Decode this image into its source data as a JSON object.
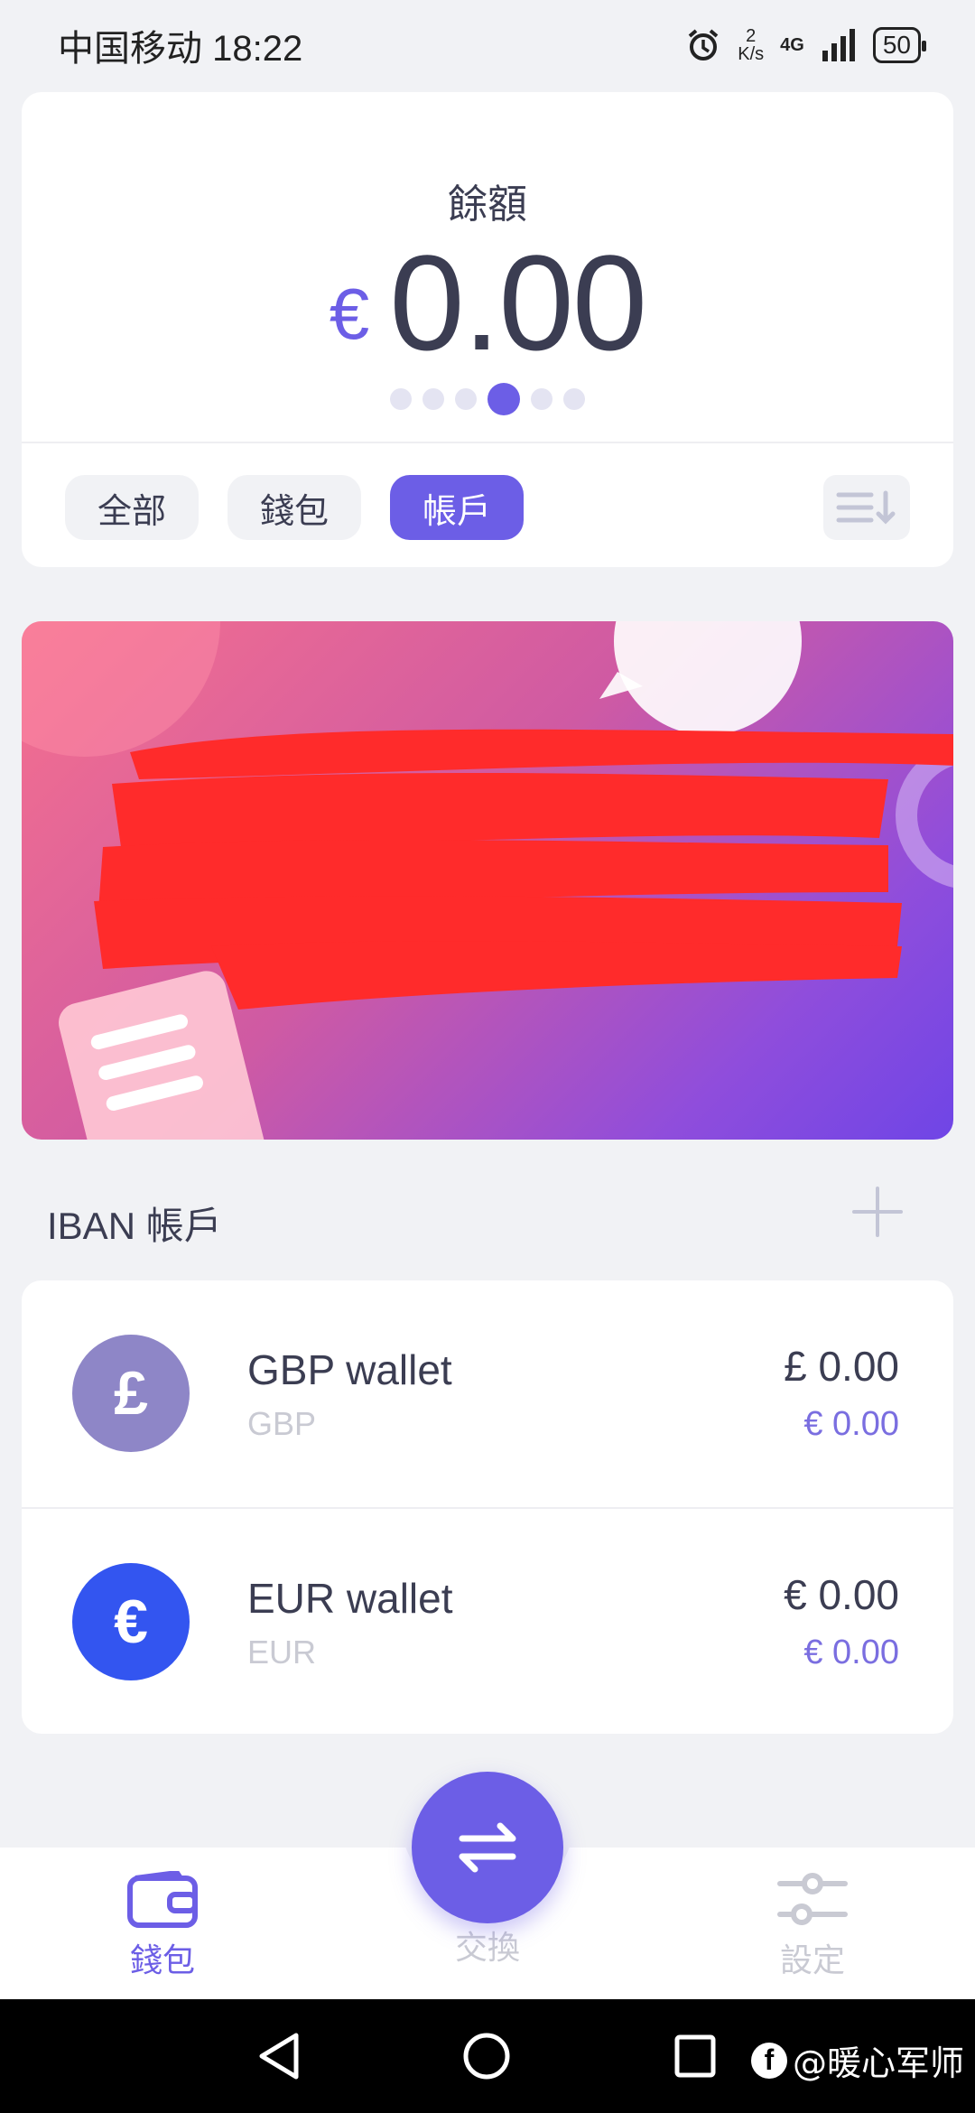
{
  "status_bar": {
    "carrier": "中国移动",
    "time": "18:22",
    "speed_value": "2",
    "speed_unit": "K/s",
    "network": "4G",
    "battery": "50",
    "icons": [
      "alarm-icon",
      "signal-icon",
      "battery-icon"
    ]
  },
  "balance": {
    "title": "餘額",
    "currency_symbol": "€",
    "amount": "0.00",
    "page_count": 6,
    "active_page": 4
  },
  "filters": {
    "items": [
      {
        "label": "全部",
        "active": false
      },
      {
        "label": "錢包",
        "active": false
      },
      {
        "label": "帳戶",
        "active": true
      }
    ],
    "sort_icon": "sort-list-icon"
  },
  "section": {
    "title": "IBAN 帳戶",
    "add_icon": "plus-icon"
  },
  "wallets": [
    {
      "symbol": "£",
      "name": "GBP wallet",
      "code": "GBP",
      "balance": "£ 0.00",
      "eur_value": "€ 0.00",
      "color": "#8e86c7"
    },
    {
      "symbol": "€",
      "name": "EUR wallet",
      "code": "EUR",
      "balance": "€ 0.00",
      "eur_value": "€ 0.00",
      "color": "#3355f0"
    }
  ],
  "bottom_nav": {
    "wallet_label": "錢包",
    "exchange_label": "交換",
    "settings_label": "設定"
  },
  "watermark": {
    "logo": "f",
    "text": "@暖心军师"
  },
  "colors": {
    "accent": "#6c5ee6",
    "background": "#f1f2f5",
    "text": "#3b3d52",
    "muted": "#c9cad3",
    "banner_start": "#f5708e",
    "banner_end": "#6f45e6",
    "redaction": "#ff2b2b"
  }
}
